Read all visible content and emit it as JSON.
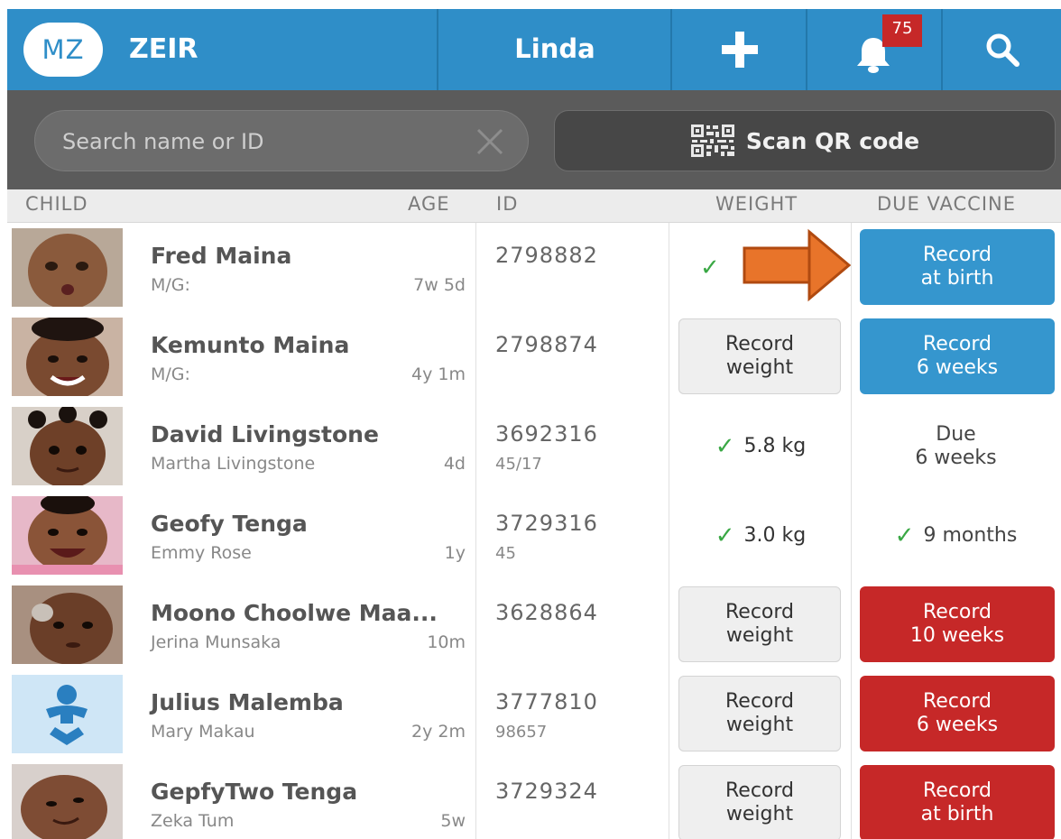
{
  "header": {
    "logo_text": "MZ",
    "app_title": "ZEIR",
    "user_name": "Linda",
    "notification_count": "75"
  },
  "toolbar": {
    "search_placeholder": "Search name or ID",
    "scan_label": "Scan QR code"
  },
  "columns": {
    "child": "CHILD",
    "age": "AGE",
    "id": "ID",
    "weight": "WEIGHT",
    "due_vaccine": "DUE VACCINE"
  },
  "rows": [
    {
      "name": "Fred Maina",
      "parent": "M/G:",
      "age": "7w 5d",
      "id": "2798882",
      "id2": "",
      "weight_done": true,
      "weight": "",
      "vaccine_style": "blue",
      "vaccine": "Record\nat birth",
      "photo": "baby-photo"
    },
    {
      "name": "Kemunto Maina",
      "parent": "M/G:",
      "age": "4y 1m",
      "id": "2798874",
      "id2": "",
      "weight_done": false,
      "weight": "Record\nweight",
      "vaccine_style": "blue",
      "vaccine": "Record\n6 weeks",
      "photo": "baby-photo"
    },
    {
      "name": "David Livingstone",
      "parent": "Martha Livingstone",
      "age": "4d",
      "id": "3692316",
      "id2": "45/17",
      "weight_done": true,
      "weight": "5.8 kg",
      "vaccine_style": "text",
      "vaccine": "Due\n6 weeks",
      "photo": "baby-photo"
    },
    {
      "name": "Geofy Tenga",
      "parent": "Emmy Rose",
      "age": "1y",
      "id": "3729316",
      "id2": "45",
      "weight_done": true,
      "weight": "3.0 kg",
      "vaccine_style": "check",
      "vaccine": "9 months",
      "photo": "baby-photo"
    },
    {
      "name": "Moono Choolwe Maa...",
      "parent": "Jerina Munsaka",
      "age": "10m",
      "id": "3628864",
      "id2": "",
      "weight_done": false,
      "weight": "Record\nweight",
      "vaccine_style": "red",
      "vaccine": "Record\n10 weeks",
      "photo": "baby-photo"
    },
    {
      "name": "Julius Malemba",
      "parent": "Mary Makau",
      "age": "2y 2m",
      "id": "3777810",
      "id2": "98657",
      "weight_done": false,
      "weight": "Record\nweight",
      "vaccine_style": "red",
      "vaccine": "Record\n6 weeks",
      "photo": "baby-placeholder-icon"
    },
    {
      "name": "GepfyTwo Tenga",
      "parent": "Zeka Tum",
      "age": "5w",
      "id": "3729324",
      "id2": "",
      "weight_done": false,
      "weight": "Record\nweight",
      "vaccine_style": "red",
      "vaccine": "Record\nat birth",
      "photo": "baby-photo"
    }
  ],
  "colors": {
    "header_blue": "#2f8ec8",
    "toolbar_gray": "#5b5b5b",
    "due_blue": "#3596ce",
    "overdue_red": "#c62828",
    "check_green": "#3aa845",
    "arrow_orange": "#e8742a"
  }
}
